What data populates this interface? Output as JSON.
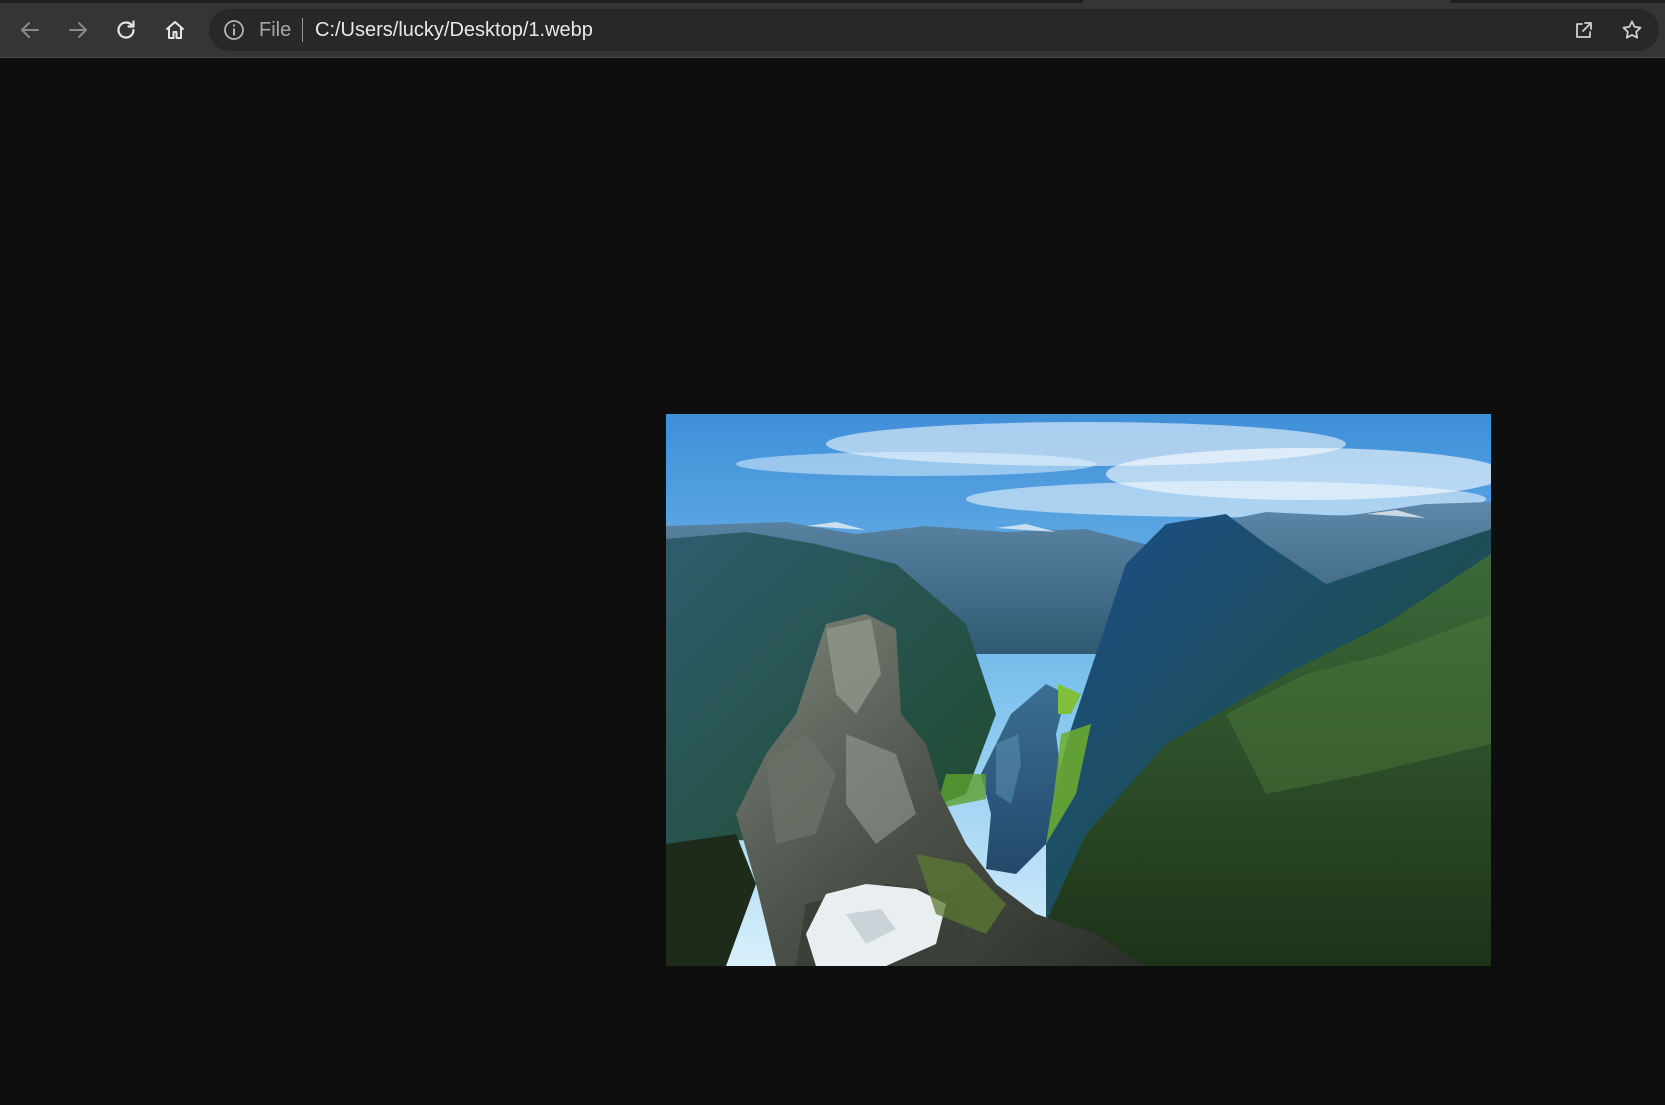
{
  "toolbar": {
    "back_icon": "arrow-left-icon",
    "forward_icon": "arrow-right-icon",
    "reload_icon": "reload-icon",
    "home_icon": "home-icon"
  },
  "omnibox": {
    "security_icon": "info-circle-icon",
    "scheme_label": "File",
    "url": "C:/Users/lucky/Desktop/1.webp",
    "share_icon": "share-icon",
    "bookmark_icon": "star-icon"
  },
  "content": {
    "image_icon": "landscape-photo",
    "background_color": "#0e0e0e"
  }
}
